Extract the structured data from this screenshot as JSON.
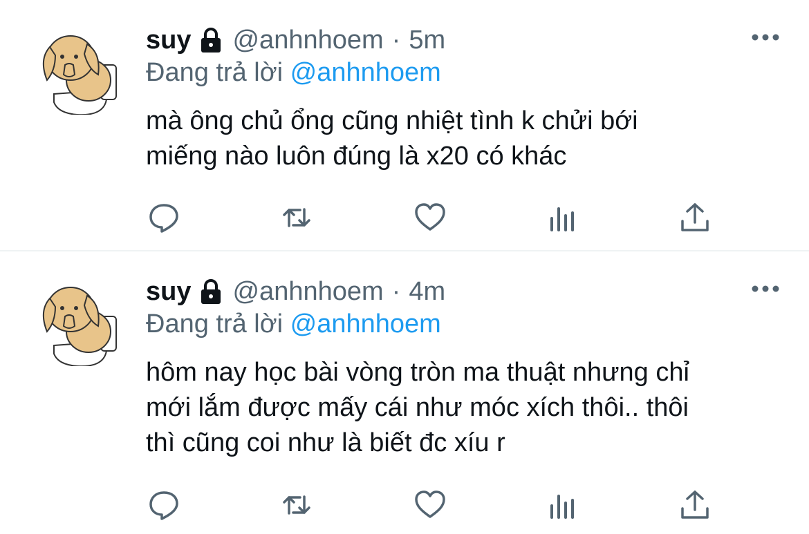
{
  "colors": {
    "accent": "#1d9bf0",
    "secondary_text": "#536471",
    "primary_text": "#0f1419",
    "icon": "#536471",
    "divider": "#eff3f4"
  },
  "tweets": [
    {
      "name": "suy",
      "handle": "@anhnhoem",
      "separator": "·",
      "time": "5m",
      "reply_prefix": "Đang trả lời",
      "reply_to": "@anhnhoem",
      "text_lines": [
        "mà ông chủ ổng cũng nhiệt tình k chửi bới",
        "miếng nào luôn đúng là x20 có khác"
      ],
      "icons": [
        "lock-icon",
        "more-icon",
        "reply-icon",
        "retweet-icon",
        "like-icon",
        "analytics-icon",
        "share-icon"
      ]
    },
    {
      "name": "suy",
      "handle": "@anhnhoem",
      "separator": "·",
      "time": "4m",
      "reply_prefix": "Đang trả lời",
      "reply_to": "@anhnhoem",
      "text_lines": [
        "hôm nay học bài vòng tròn ma thuật nhưng chỉ",
        "mới lắm được mấy cái như móc xích thôi.. thôi",
        "thì cũng coi như là biết đc xíu r"
      ],
      "icons": [
        "lock-icon",
        "more-icon",
        "reply-icon",
        "retweet-icon",
        "like-icon",
        "analytics-icon",
        "share-icon"
      ]
    }
  ]
}
